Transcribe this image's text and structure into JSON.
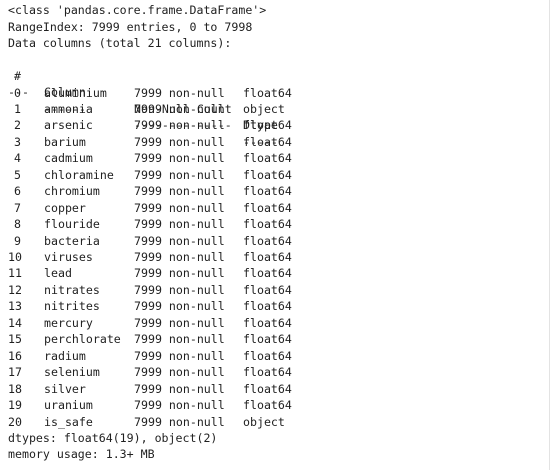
{
  "header": {
    "class_line": "<class 'pandas.core.frame.DataFrame'>",
    "range_index": "RangeIndex: 7999 entries, 0 to 7998",
    "data_columns": "Data columns (total 21 columns):"
  },
  "table": {
    "headers": [
      "#",
      "Column",
      "Non-Null Count",
      "Dtype"
    ],
    "separators": [
      "---",
      "------",
      "--------------",
      "-----"
    ],
    "rows": [
      {
        "idx": "0",
        "name": "aluminium",
        "count": "7999 non-null",
        "dtype": "float64"
      },
      {
        "idx": "1",
        "name": "ammonia",
        "count": "7999 non-null",
        "dtype": "object"
      },
      {
        "idx": "2",
        "name": "arsenic",
        "count": "7999 non-null",
        "dtype": "float64"
      },
      {
        "idx": "3",
        "name": "barium",
        "count": "7999 non-null",
        "dtype": "float64"
      },
      {
        "idx": "4",
        "name": "cadmium",
        "count": "7999 non-null",
        "dtype": "float64"
      },
      {
        "idx": "5",
        "name": "chloramine",
        "count": "7999 non-null",
        "dtype": "float64"
      },
      {
        "idx": "6",
        "name": "chromium",
        "count": "7999 non-null",
        "dtype": "float64"
      },
      {
        "idx": "7",
        "name": "copper",
        "count": "7999 non-null",
        "dtype": "float64"
      },
      {
        "idx": "8",
        "name": "flouride",
        "count": "7999 non-null",
        "dtype": "float64"
      },
      {
        "idx": "9",
        "name": "bacteria",
        "count": "7999 non-null",
        "dtype": "float64"
      },
      {
        "idx": "10",
        "name": "viruses",
        "count": "7999 non-null",
        "dtype": "float64"
      },
      {
        "idx": "11",
        "name": "lead",
        "count": "7999 non-null",
        "dtype": "float64"
      },
      {
        "idx": "12",
        "name": "nitrates",
        "count": "7999 non-null",
        "dtype": "float64"
      },
      {
        "idx": "13",
        "name": "nitrites",
        "count": "7999 non-null",
        "dtype": "float64"
      },
      {
        "idx": "14",
        "name": "mercury",
        "count": "7999 non-null",
        "dtype": "float64"
      },
      {
        "idx": "15",
        "name": "perchlorate",
        "count": "7999 non-null",
        "dtype": "float64"
      },
      {
        "idx": "16",
        "name": "radium",
        "count": "7999 non-null",
        "dtype": "float64"
      },
      {
        "idx": "17",
        "name": "selenium",
        "count": "7999 non-null",
        "dtype": "float64"
      },
      {
        "idx": "18",
        "name": "silver",
        "count": "7999 non-null",
        "dtype": "float64"
      },
      {
        "idx": "19",
        "name": "uranium",
        "count": "7999 non-null",
        "dtype": "float64"
      },
      {
        "idx": "20",
        "name": "is_safe",
        "count": "7999 non-null",
        "dtype": "object"
      }
    ]
  },
  "footer": {
    "dtypes": "dtypes: float64(19), object(2)",
    "memory": "memory usage: 1.3+ MB"
  }
}
